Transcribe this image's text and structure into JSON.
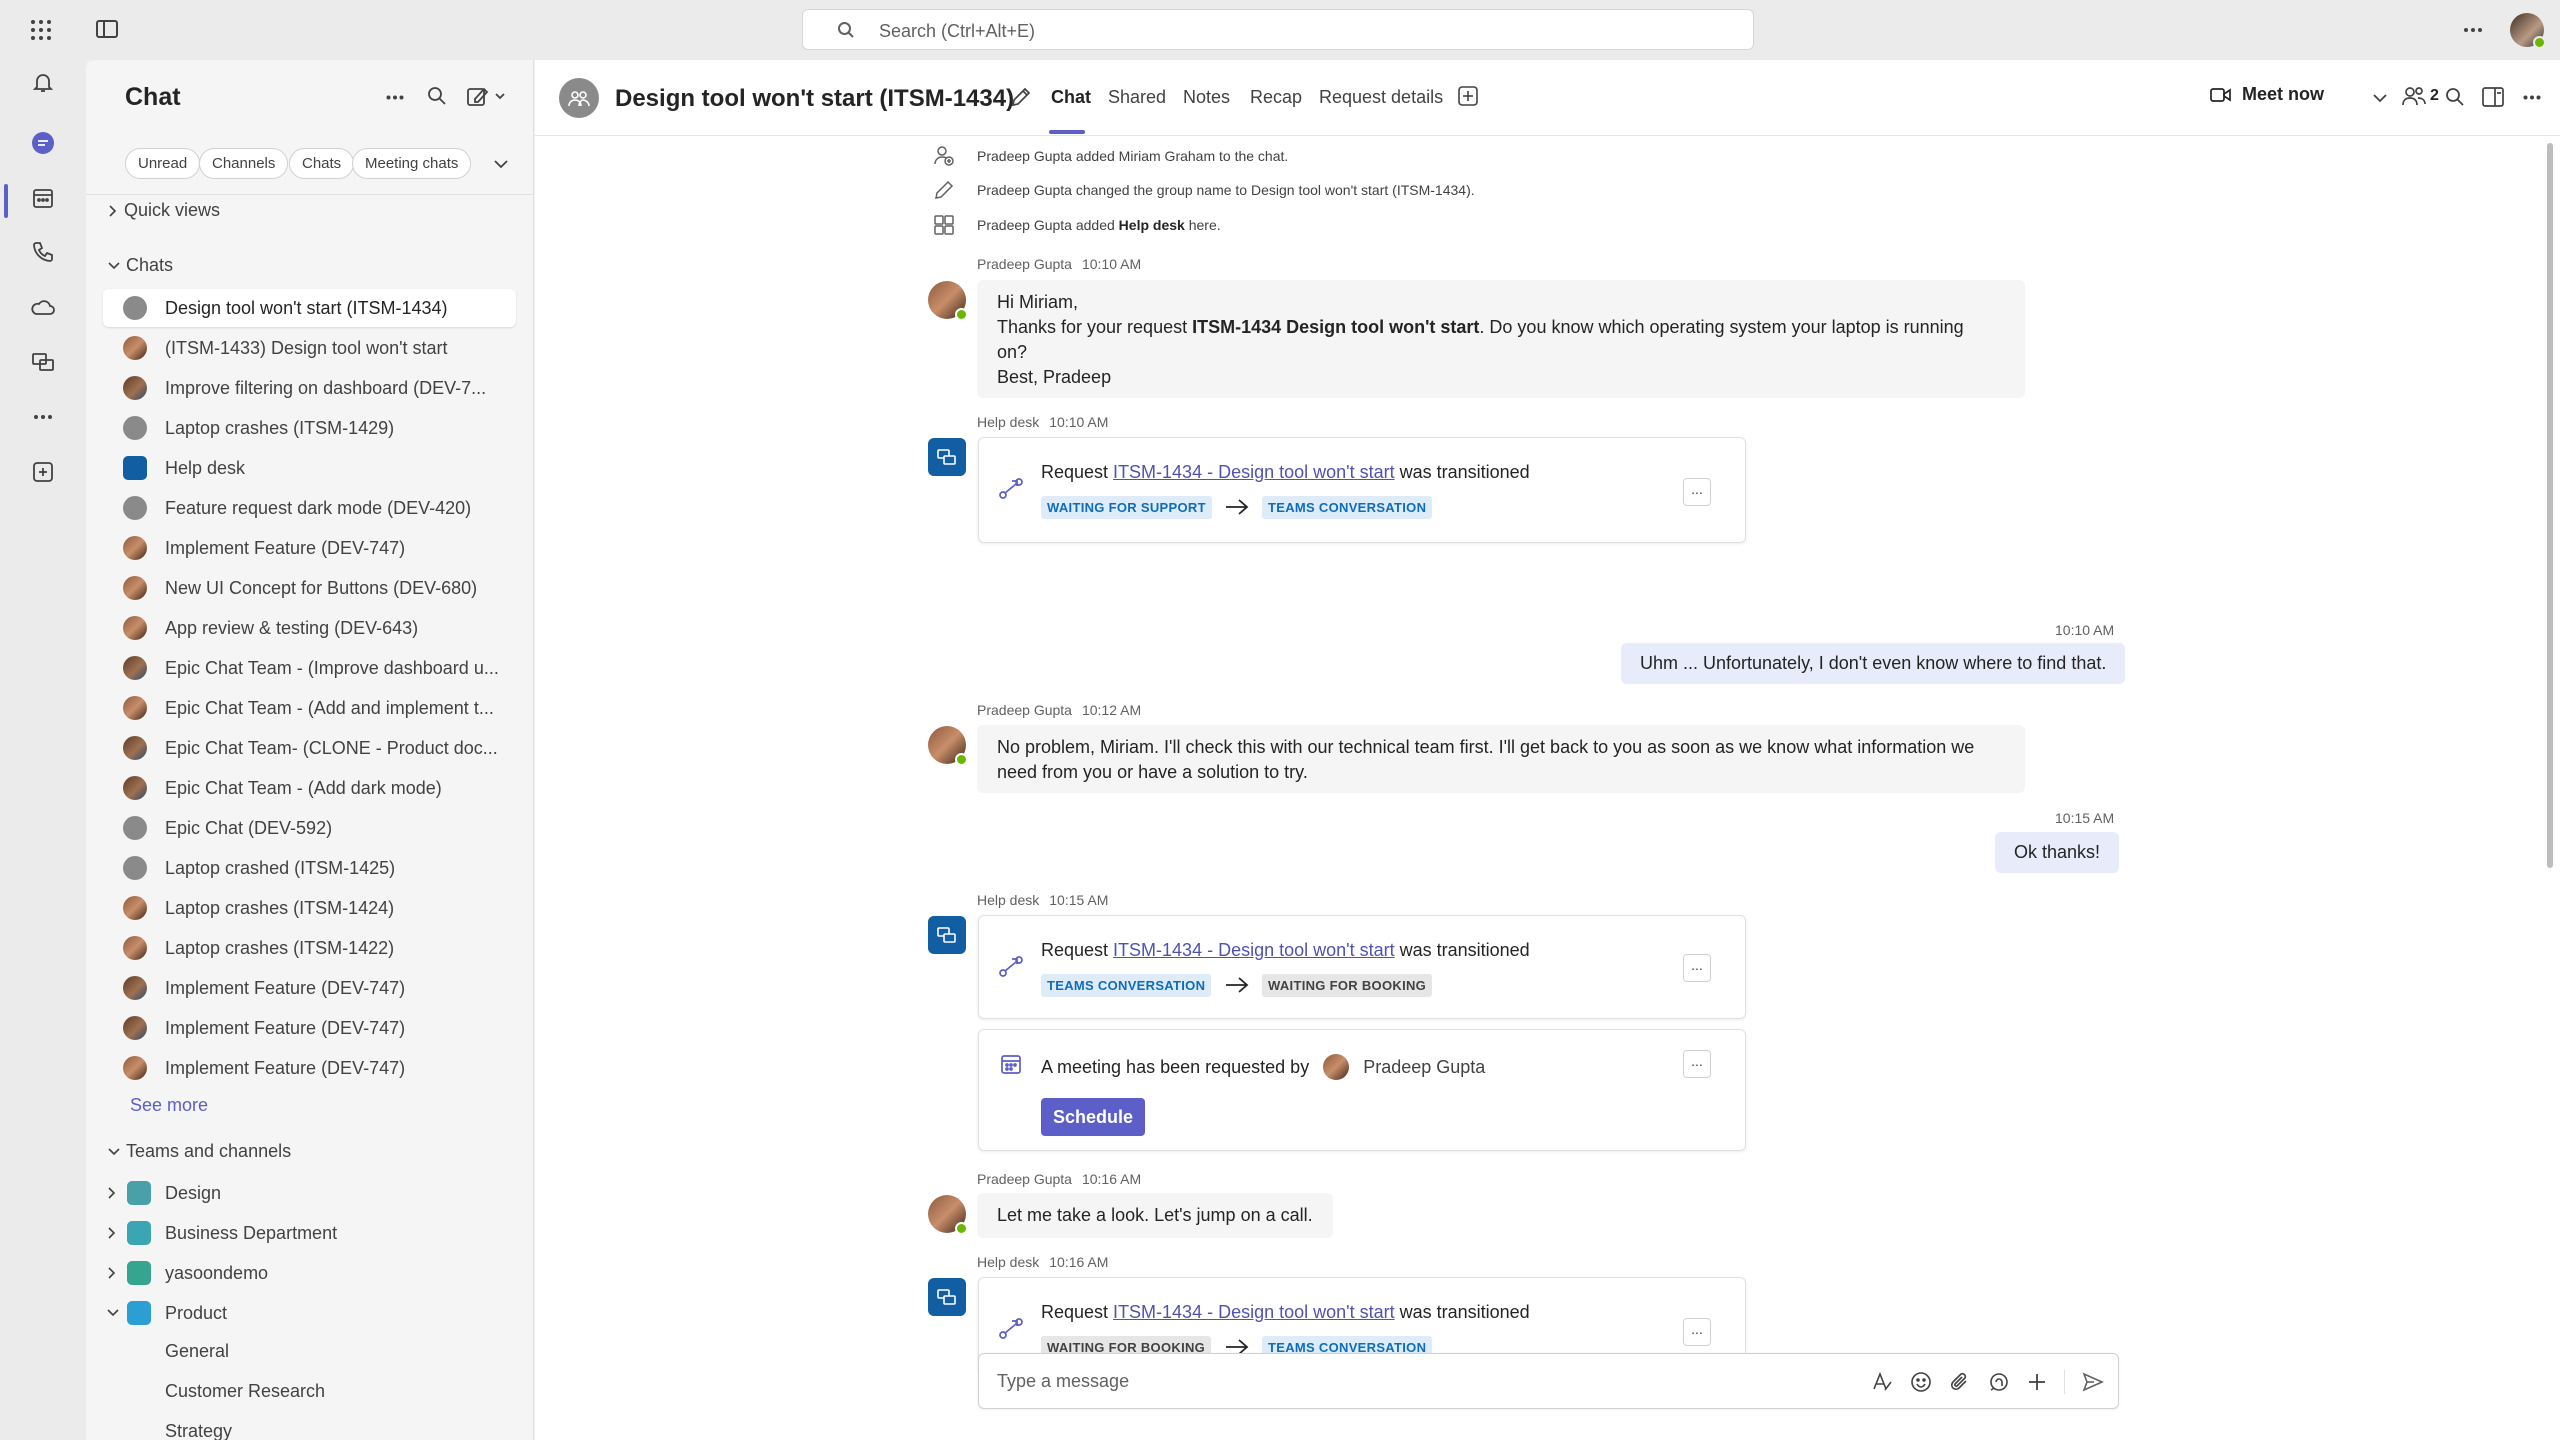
{
  "topbar": {
    "search_placeholder": "Search (Ctrl+Alt+E)"
  },
  "rail": {
    "items": [
      "bell-icon",
      "chat-icon",
      "calendar-icon",
      "calls-icon",
      "onedrive-icon",
      "helpdesk-app-icon",
      "more-apps-icon",
      "add-apps-icon"
    ],
    "active": "chat-icon"
  },
  "leftpane": {
    "title": "Chat",
    "filters": [
      "Unread",
      "Channels",
      "Chats",
      "Meeting chats"
    ],
    "quick_views": "Quick views",
    "chats_heading": "Chats",
    "chats": [
      "Design tool won't start (ITSM-1434)",
      "(ITSM-1433) Design tool won't start",
      "Improve filtering on dashboard (DEV-7...",
      "Laptop crashes (ITSM-1429)",
      "Help desk",
      "Feature request dark mode (DEV-420)",
      "Implement Feature (DEV-747)",
      "New UI Concept for Buttons (DEV-680)",
      "App review & testing (DEV-643)",
      "Epic Chat Team - (Improve dashboard u...",
      "Epic Chat Team - (Add and implement t...",
      "Epic Chat Team- (CLONE - Product doc...",
      "Epic Chat Team - (Add dark mode)",
      "Epic Chat (DEV-592)",
      "Laptop crashed (ITSM-1425)",
      "Laptop crashes (ITSM-1424)",
      "Laptop crashes (ITSM-1422)",
      "Implement Feature (DEV-747)",
      "Implement Feature (DEV-747)",
      "Implement Feature (DEV-747)"
    ],
    "see_more": "See more",
    "teams_heading": "Teams and channels",
    "teams": [
      "Design",
      "Business Department",
      "yasoondemo",
      "Product"
    ],
    "channels": [
      "General",
      "Customer Research",
      "Strategy"
    ]
  },
  "header": {
    "title": "Design tool won't start (ITSM-1434)",
    "tabs": [
      "Chat",
      "Shared",
      "Notes",
      "Recap",
      "Request details"
    ],
    "active_tab": "Chat",
    "meet_now": "Meet now",
    "participants": "2"
  },
  "messages": {
    "sys1": "Pradeep Gupta added Miriam Graham to the chat.",
    "sys2": "Pradeep Gupta changed the group name to Design tool won't start (ITSM-1434).",
    "sys3_pre": "Pradeep Gupta added ",
    "sys3_bold": "Help desk",
    "sys3_post": " here.",
    "m1": {
      "author": "Pradeep Gupta",
      "time": "10:10 AM",
      "l1": "Hi Miriam,",
      "l2_pre": "Thanks for your request ",
      "l2_bold": "ITSM-1434 Design tool won't start",
      "l2_post": ". Do you know which operating system your laptop is running",
      "l3": "on?",
      "l4": "Best, Pradeep"
    },
    "hd1": {
      "author": "Help desk",
      "time": "10:10 AM",
      "pre": "Request ",
      "link": "ITSM-1434 - Design tool won't start",
      "post": " was transitioned",
      "from": "WAITING FOR SUPPORT",
      "to": "TEAMS CONVERSATION",
      "more": "..."
    },
    "me1": {
      "time": "10:10 AM",
      "text": "Uhm ... Unfortunately, I don't even know where to find that."
    },
    "m2": {
      "author": "Pradeep Gupta",
      "time": "10:12 AM",
      "l1": "No problem, Miriam. I'll check this with our technical team first. I'll get back to you as soon as we know what information we",
      "l2": "need from you or have a solution to try."
    },
    "me2": {
      "time": "10:15 AM",
      "text": "Ok thanks!"
    },
    "hd2": {
      "author": "Help desk",
      "time": "10:15 AM",
      "pre": "Request ",
      "link": "ITSM-1434 - Design tool won't start",
      "post": " was transitioned",
      "from": "TEAMS CONVERSATION",
      "to": "WAITING FOR BOOKING",
      "more": "..."
    },
    "meeting": {
      "text": "A meeting has been requested by",
      "person": "Pradeep Gupta",
      "button": "Schedule",
      "more": "..."
    },
    "m3": {
      "author": "Pradeep Gupta",
      "time": "10:16 AM",
      "text": "Let me take a look. Let's jump on a call."
    },
    "hd3": {
      "author": "Help desk",
      "time": "10:16 AM",
      "pre": "Request ",
      "link": "ITSM-1434 - Design tool won't start",
      "post": " was transitioned",
      "from": "WAITING FOR BOOKING",
      "to": "TEAMS CONVERSATION",
      "more": "..."
    }
  },
  "compose": {
    "placeholder": "Type a message"
  },
  "colors": {
    "accent": "#5b5fc7",
    "link": "#4f52b2",
    "presence": "#6bb700",
    "helpdesk": "#115ea3"
  }
}
